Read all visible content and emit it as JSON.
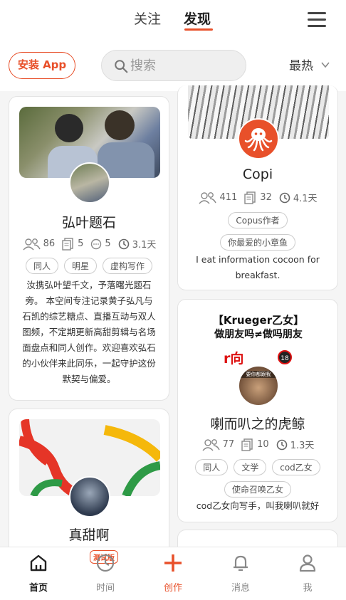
{
  "header": {
    "tab_follow": "关注",
    "tab_discover": "发现"
  },
  "toolbar": {
    "install_label": "安装 App",
    "search_placeholder": "搜索",
    "sort_label": "最热"
  },
  "cards": [
    {
      "title": "弘叶题石",
      "stats": {
        "followers": "86",
        "posts": "5",
        "comments": "5",
        "time": "3.1天"
      },
      "tags": [
        "同人",
        "明星",
        "虚构写作"
      ],
      "description": "汝携弘叶望千文，予落曙光题石旁。 本空间专注记录黄子弘凡与石凯的综艺糖点、直播互动与双人图频，不定期更新高甜剪辑与名场面盘点和同人创作。欢迎喜欢弘石的小伙伴来此同乐，一起守护这份默契与偏爱。"
    },
    {
      "title": "Copi",
      "stats": {
        "followers": "411",
        "posts": "32",
        "time": "4.1天"
      },
      "tags": [
        "Copus作者",
        "你最爱的小章鱼"
      ],
      "description": "I eat information cocoon for breakfast."
    },
    {
      "cover_text_line1": "【Krueger乙女】",
      "cover_text_line2": "做朋友吗≠做吗朋友",
      "cover_red": "r向",
      "cover_badge": "18",
      "avatar_caption": "要你都跟我",
      "title": "喇而叭之的虎鲸",
      "stats": {
        "followers": "77",
        "posts": "10",
        "time": "1.3天"
      },
      "tags": [
        "同人",
        "文学",
        "cod乙女",
        "使命召唤乙女"
      ],
      "description": "cod乙女向写手，叫我喇叭就好"
    },
    {
      "title": "真甜啊"
    }
  ],
  "bottom_nav": {
    "home": "首页",
    "time": "时间",
    "beta": "测试版",
    "create": "创作",
    "messages": "消息",
    "me": "我"
  },
  "colors": {
    "accent": "#e8502a",
    "background": "#f5f5f5"
  }
}
